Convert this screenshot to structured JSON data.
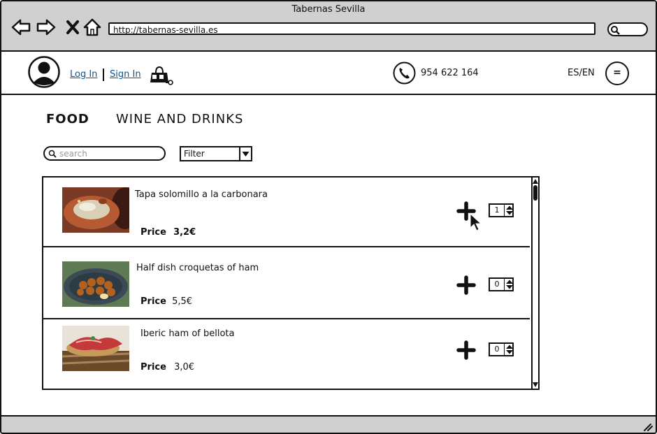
{
  "window": {
    "title": "Tabernas Sevilla",
    "url": "http://tabernas-sevilla.es"
  },
  "header": {
    "login_label": "Log In",
    "signin_label": "Sign In",
    "phone": "954 622 164",
    "lang_label": "ES/EN",
    "menu_label": "="
  },
  "tabs": [
    {
      "label": "FOOD",
      "active": true
    },
    {
      "label": "WINE AND DRINKS",
      "active": false
    }
  ],
  "search": {
    "placeholder": "search"
  },
  "filter": {
    "label": "Filter"
  },
  "items": [
    {
      "name": "Tapa solomillo a la carbonara",
      "price_label": "Price",
      "price": "3,2€",
      "qty": "1",
      "image": "dish-photo"
    },
    {
      "name": "Half dish croquetas  of ham",
      "price_label": "Price",
      "price": "5,5€",
      "qty": "0",
      "image": "croquetas-photo"
    },
    {
      "name": "Iberic ham of bellota",
      "price_label": "Price",
      "price": "3,0€",
      "qty": "0",
      "image": "ham-photo"
    }
  ],
  "colors": {
    "chrome": "#d0d0d0",
    "link": "#0b5394"
  }
}
